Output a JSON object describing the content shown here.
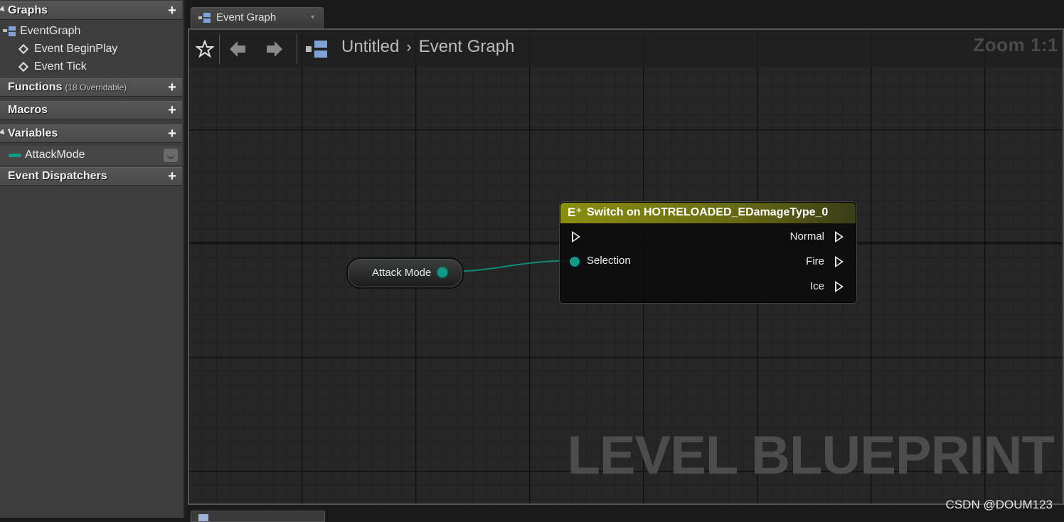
{
  "left_panel": {
    "graphs_header": "Graphs",
    "graph_items": [
      "EventGraph",
      "Event BeginPlay",
      "Event Tick"
    ],
    "functions_header": "Functions",
    "functions_sub": "(18 Overridable)",
    "macros_header": "Macros",
    "variables_header": "Variables",
    "variable_name": "AttackMode",
    "dispatchers_header": "Event Dispatchers"
  },
  "tab": {
    "label": "Event Graph"
  },
  "toolbar": {
    "breadcrumb_root": "Untitled",
    "breadcrumb_current": "Event Graph",
    "zoom": "Zoom 1:1"
  },
  "nodes": {
    "variable_node_label": "Attack Mode",
    "switch_title": "Switch on HOTRELOADED_EDamageType_0",
    "switch_input": "Selection",
    "switch_outputs": [
      "Normal",
      "Fire",
      "Ice"
    ]
  },
  "watermark": "LEVEL BLUEPRINT",
  "credit": "CSDN @DOUM123",
  "colors": {
    "switch_header": "#8b8f0f",
    "enum_pin": "#0f9a8a",
    "panel_bg": "#3d3d3d",
    "canvas_bg": "#262626"
  }
}
